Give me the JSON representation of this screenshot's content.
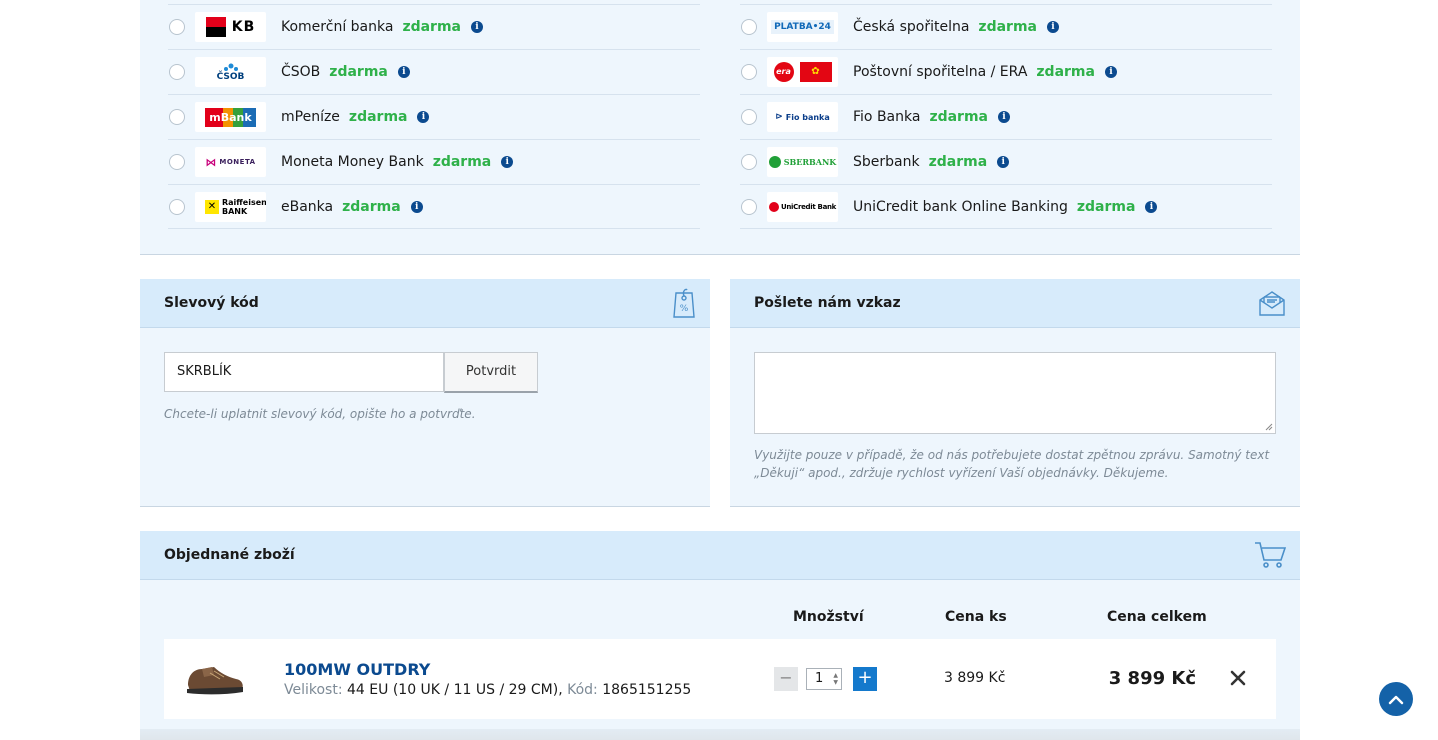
{
  "banks": {
    "free_label": "zdarma",
    "info_glyph": "i",
    "left": [
      {
        "name": "Komerční banka",
        "logo": "KB",
        "icon": "kb-logo-icon"
      },
      {
        "name": "ČSOB",
        "logo": "ČSOB",
        "icon": "csob-logo-icon"
      },
      {
        "name": "mPeníze",
        "logo": "mBank",
        "icon": "mbank-logo-icon"
      },
      {
        "name": "Moneta Money Bank",
        "logo": "MONETA",
        "icon": "moneta-logo-icon"
      },
      {
        "name": "eBanka",
        "logo": "Raiffeisen BANK",
        "icon": "raiffeisen-logo-icon"
      }
    ],
    "right": [
      {
        "name": "Česká spořitelna",
        "logo": "PLATBA•24",
        "icon": "platba24-logo-icon"
      },
      {
        "name": "Poštovní spořitelna / ERA",
        "logo": "era",
        "icon": "era-logo-icon"
      },
      {
        "name": "Fio Banka",
        "logo": "Fio banka",
        "icon": "fio-logo-icon"
      },
      {
        "name": "Sberbank",
        "logo": "SBERBANK",
        "icon": "sberbank-logo-icon"
      },
      {
        "name": "UniCredit bank Online Banking",
        "logo": "UniCredit Bank",
        "icon": "unicredit-logo-icon"
      }
    ]
  },
  "discount": {
    "title": "Slevový kód",
    "icon": "discount-tag-icon",
    "value": "SKRBLÍK",
    "button": "Potvrdit",
    "hint": "Chcete-li uplatnit slevový kód, opište ho a potvrďte."
  },
  "message": {
    "title": "Pošlete nám vzkaz",
    "icon": "mail-icon",
    "hint_line1": "Využijte pouze v případě, že od nás potřebujete dostat zpětnou zprávu. Samotný text",
    "hint_line2": "„Děkuji“ apod., zdržuje rychlost vyřízení Vaší objednávky. Děkujeme."
  },
  "order": {
    "title": "Objednané zboží",
    "icon": "cart-icon",
    "columns": {
      "qty": "Množství",
      "unit": "Cena ks",
      "total": "Cena celkem"
    },
    "item": {
      "name": "100MW OUTDRY",
      "size_label": "Velikost:",
      "size": "44 EU (10 UK / 11 US / 29 CM),",
      "code_label": "Kód:",
      "code": "1865151255",
      "qty": "1",
      "minus": "−",
      "plus": "+",
      "unit_price": "3 899 Kč",
      "total_price": "3 899 Kč"
    }
  },
  "colors": {
    "accent": "#0b4a8f",
    "free": "#2fb14a",
    "panel": "#eef6fd",
    "header": "#d7ebfb",
    "plus_button": "#1479cc"
  }
}
